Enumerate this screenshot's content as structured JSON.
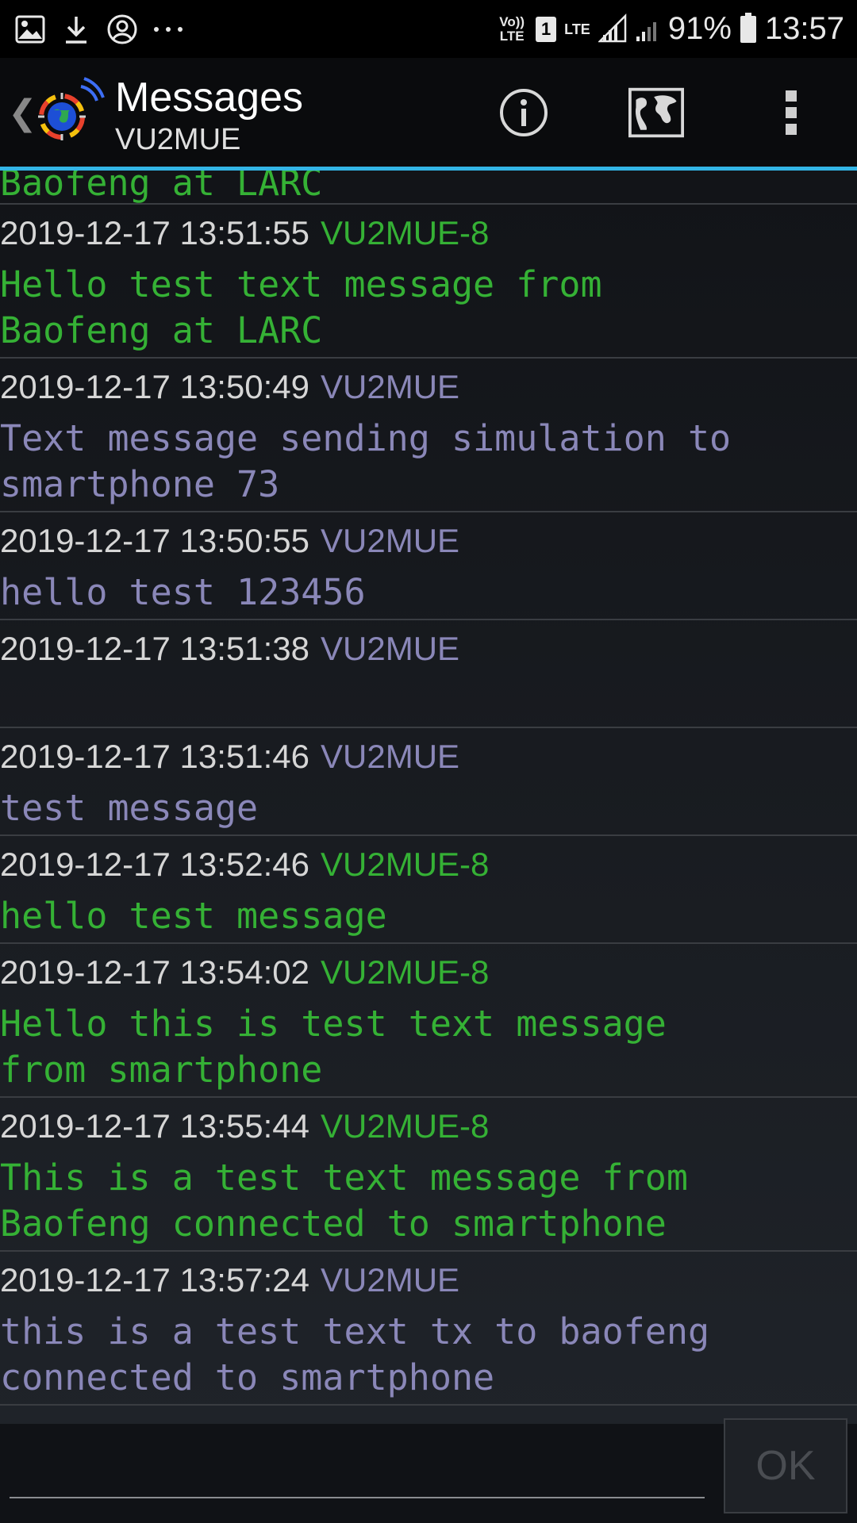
{
  "status_bar": {
    "volte": "Vo)) LTE",
    "sim": "1",
    "lte": "LTE",
    "battery": "91%",
    "time": "13:57",
    "left_icons": [
      "image-icon",
      "download-icon",
      "account-circle-icon",
      "more-horiz-icon"
    ]
  },
  "action_bar": {
    "title": "Messages",
    "subtitle": "VU2MUE",
    "icons": [
      "info-icon",
      "map-icon",
      "overflow-menu-icon"
    ]
  },
  "colors": {
    "remote": "#35b135",
    "local": "#8a87b8",
    "accent": "#33b5e5"
  },
  "messages": [
    {
      "partial": true,
      "timestamp": "",
      "callsign": "",
      "text": "Baofeng at LARC",
      "kind": "remote"
    },
    {
      "timestamp": "2019-12-17 13:51:55",
      "callsign": "VU2MUE-8",
      "text": "Hello test text message from\nBaofeng at LARC",
      "kind": "remote"
    },
    {
      "timestamp": "2019-12-17 13:50:49",
      "callsign": "VU2MUE",
      "text": "Text message sending simulation to\nsmartphone 73",
      "kind": "local"
    },
    {
      "timestamp": "2019-12-17 13:50:55",
      "callsign": "VU2MUE",
      "text": "hello test 123456",
      "kind": "local"
    },
    {
      "timestamp": "2019-12-17 13:51:38",
      "callsign": "VU2MUE",
      "text": "",
      "kind": "local"
    },
    {
      "timestamp": "2019-12-17 13:51:46",
      "callsign": "VU2MUE",
      "text": "test message",
      "kind": "local"
    },
    {
      "timestamp": "2019-12-17 13:52:46",
      "callsign": "VU2MUE-8",
      "text": "hello test message",
      "kind": "remote"
    },
    {
      "timestamp": "2019-12-17 13:54:02",
      "callsign": "VU2MUE-8",
      "text": "Hello this is test text message\nfrom smartphone",
      "kind": "remote"
    },
    {
      "timestamp": "2019-12-17 13:55:44",
      "callsign": "VU2MUE-8",
      "text": "This is a test text message from\nBaofeng connected to smartphone",
      "kind": "remote"
    },
    {
      "timestamp": "2019-12-17 13:57:24",
      "callsign": "VU2MUE",
      "text": "this is a test text tx to baofeng\nconnected to smartphone",
      "kind": "local"
    }
  ],
  "composer": {
    "value": "",
    "ok_label": "OK"
  }
}
